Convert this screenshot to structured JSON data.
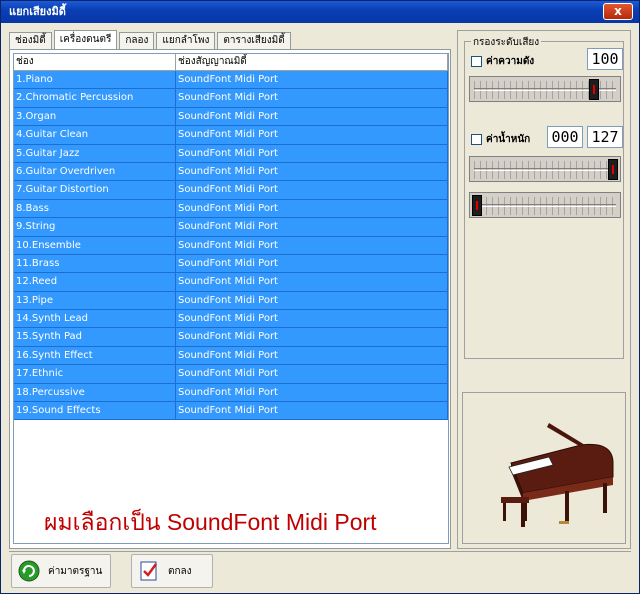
{
  "window": {
    "title": "แยกเสียงมิดี้",
    "close_label": "x"
  },
  "tabs": [
    {
      "label": "ช่องมิดี้",
      "active": false
    },
    {
      "label": "เครื่องดนตรี",
      "active": true
    },
    {
      "label": "กลอง",
      "active": false
    },
    {
      "label": "แยกลำโพง",
      "active": false
    },
    {
      "label": "ตารางเสียงมิดี้",
      "active": false
    }
  ],
  "grid": {
    "headers": [
      "ช่อง",
      "ช่องสัญญาณมิดี้"
    ],
    "rows": [
      [
        "1.Piano",
        "SoundFont Midi Port"
      ],
      [
        "2.Chromatic Percussion",
        "SoundFont Midi Port"
      ],
      [
        "3.Organ",
        "SoundFont Midi Port"
      ],
      [
        "4.Guitar Clean",
        "SoundFont Midi Port"
      ],
      [
        "5.Guitar Jazz",
        "SoundFont Midi Port"
      ],
      [
        "6.Guitar Overdriven",
        "SoundFont Midi Port"
      ],
      [
        "7.Guitar Distortion",
        "SoundFont Midi Port"
      ],
      [
        "8.Bass",
        "SoundFont Midi Port"
      ],
      [
        "9.String",
        "SoundFont Midi Port"
      ],
      [
        "10.Ensemble",
        "SoundFont Midi Port"
      ],
      [
        "11.Brass",
        "SoundFont Midi Port"
      ],
      [
        "12.Reed",
        "SoundFont Midi Port"
      ],
      [
        "13.Pipe",
        "SoundFont Midi Port"
      ],
      [
        "14.Synth Lead",
        "SoundFont Midi Port"
      ],
      [
        "15.Synth Pad",
        "SoundFont Midi Port"
      ],
      [
        "16.Synth Effect",
        "SoundFont Midi Port"
      ],
      [
        "17.Ethnic",
        "SoundFont Midi Port"
      ],
      [
        "18.Percussive",
        "SoundFont Midi Port"
      ],
      [
        "19.Sound Effects",
        "SoundFont Midi Port"
      ]
    ]
  },
  "note_text": "ผมเลือกเป็น SoundFont Midi Port",
  "filter": {
    "group_label": "กรองระดับเสียง",
    "volume_label": "ค่าความดัง",
    "volume_value": "100",
    "volume_checked": false,
    "volume_slider_level": 0.86,
    "weight_label": "ค่าน้ำหนัก",
    "weight_min": "000",
    "weight_max": "127",
    "weight_checked": false,
    "weight_max_slider_level": 1.0,
    "weight_min_slider_level": 0.0
  },
  "buttons": {
    "default_label": "ค่ามาตรฐาน",
    "ok_label": "ตกลง"
  },
  "icons": {
    "default": "refresh-arrow-icon",
    "ok": "checkmark-document-icon",
    "preview": "grand-piano-icon"
  },
  "colors": {
    "selection": "#3399ff",
    "note": "#c00000",
    "titlebar": "#0a3fb5"
  }
}
